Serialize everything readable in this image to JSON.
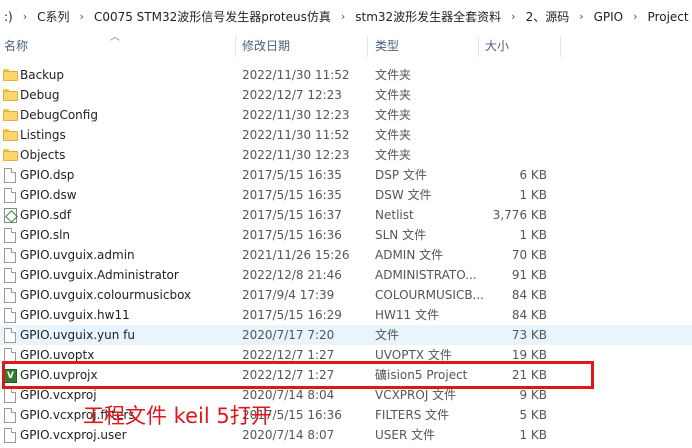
{
  "breadcrumb": [
    ":)",
    "C系列",
    "C0075 STM32波形信号发生器proteus仿真",
    "stm32波形发生器全套资料",
    "2、源码",
    "GPIO",
    "Project"
  ],
  "headers": {
    "name": "名称",
    "date": "修改日期",
    "type": "类型",
    "size": "大小"
  },
  "files": [
    {
      "name": "Backup",
      "date": "2022/11/30 11:52",
      "type": "文件夹",
      "size": "",
      "icon": "folder-icon"
    },
    {
      "name": "Debug",
      "date": "2022/12/7 12:23",
      "type": "文件夹",
      "size": "",
      "icon": "folder-icon"
    },
    {
      "name": "DebugConfig",
      "date": "2022/11/30 12:23",
      "type": "文件夹",
      "size": "",
      "icon": "folder-icon"
    },
    {
      "name": "Listings",
      "date": "2022/11/30 11:52",
      "type": "文件夹",
      "size": "",
      "icon": "folder-icon"
    },
    {
      "name": "Objects",
      "date": "2022/11/30 12:23",
      "type": "文件夹",
      "size": "",
      "icon": "folder-icon"
    },
    {
      "name": "GPIO.dsp",
      "date": "2017/5/15 16:35",
      "type": "DSP 文件",
      "size": "6 KB",
      "icon": "file-icon"
    },
    {
      "name": "GPIO.dsw",
      "date": "2017/5/15 16:35",
      "type": "DSW 文件",
      "size": "1 KB",
      "icon": "file-icon"
    },
    {
      "name": "GPIO.sdf",
      "date": "2017/5/15 16:37",
      "type": "Netlist",
      "size": "3,776 KB",
      "icon": "netlist-icon"
    },
    {
      "name": "GPIO.sln",
      "date": "2017/5/15 16:36",
      "type": "SLN 文件",
      "size": "1 KB",
      "icon": "file-icon"
    },
    {
      "name": "GPIO.uvguix.admin",
      "date": "2021/11/26 15:26",
      "type": "ADMIN 文件",
      "size": "70 KB",
      "icon": "file-icon"
    },
    {
      "name": "GPIO.uvguix.Administrator",
      "date": "2022/12/8 21:46",
      "type": "ADMINISTRATO...",
      "size": "91 KB",
      "icon": "file-icon"
    },
    {
      "name": "GPIO.uvguix.colourmusicbox",
      "date": "2017/9/4 17:39",
      "type": "COLOURMUSICB...",
      "size": "84 KB",
      "icon": "file-icon"
    },
    {
      "name": "GPIO.uvguix.hw11",
      "date": "2017/5/15 16:29",
      "type": "HW11 文件",
      "size": "84 KB",
      "icon": "file-icon"
    },
    {
      "name": "GPIO.uvguix.yun fu",
      "date": "2020/7/17 7:20",
      "type": "文件",
      "size": "73 KB",
      "icon": "file-icon",
      "selected": true
    },
    {
      "name": "GPIO.uvoptx",
      "date": "2022/12/7 1:27",
      "type": "UVOPTX 文件",
      "size": "19 KB",
      "icon": "file-icon"
    },
    {
      "name": "GPIO.uvprojx",
      "date": "2022/12/7 1:27",
      "type": "礦ision5 Project",
      "size": "21 KB",
      "icon": "keil-project-icon"
    },
    {
      "name": "GPIO.vcxproj",
      "date": "2020/7/14 8:04",
      "type": "VCXPROJ 文件",
      "size": "9 KB",
      "icon": "file-icon"
    },
    {
      "name": "GPIO.vcxproj.filters",
      "date": "2017/5/15 16:36",
      "type": "FILTERS 文件",
      "size": "5 KB",
      "icon": "file-icon"
    },
    {
      "name": "GPIO.vcxproj.user",
      "date": "2020/7/14 8:07",
      "type": "USER 文件",
      "size": "1 KB",
      "icon": "file-icon"
    }
  ],
  "annotation": "工程文件 keil 5打开",
  "colors": {
    "highlight": "#e0161b",
    "selection": "#eaf4fd",
    "header_text": "#4c607a"
  }
}
